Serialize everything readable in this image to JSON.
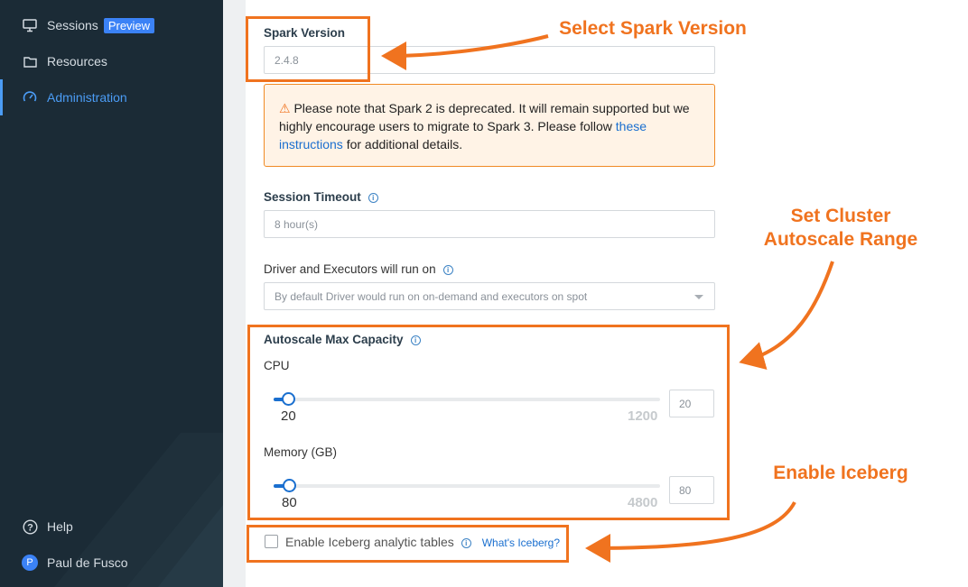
{
  "sidebar": {
    "items": [
      {
        "label": "Sessions",
        "icon": "monitor-icon",
        "badge": "Preview"
      },
      {
        "label": "Resources",
        "icon": "folder-icon"
      },
      {
        "label": "Administration",
        "icon": "gauge-icon",
        "active": true
      }
    ],
    "help": {
      "label": "Help",
      "icon": "help-icon"
    },
    "user": {
      "name": "Paul de Fusco",
      "initial": "P"
    }
  },
  "form": {
    "spark_version": {
      "label": "Spark Version",
      "value": "2.4.8"
    },
    "warning": {
      "text_before": " Please note that Spark 2 is deprecated. It will remain supported but we highly encourage users to migrate to Spark 3. Please follow ",
      "link": "these instructions",
      "text_after": " for additional details."
    },
    "session_timeout": {
      "label": "Session Timeout",
      "placeholder": "8 hour(s)"
    },
    "driver_executors": {
      "label": "Driver and Executors will run on",
      "placeholder": "By default Driver would run on on-demand and executors on spot"
    },
    "autoscale": {
      "label": "Autoscale Max Capacity",
      "cpu": {
        "label": "CPU",
        "min": "20",
        "max": "1200",
        "value": "20",
        "fraction": 0.0
      },
      "memory": {
        "label": "Memory (GB)",
        "min": "80",
        "max": "4800",
        "value": "80",
        "fraction": 0.0
      }
    },
    "iceberg": {
      "label": "Enable Iceberg analytic tables",
      "link": "What's Iceberg?",
      "checked": false
    }
  },
  "annotations": {
    "spark": "Select Spark Version",
    "autoscale_line1": "Set Cluster",
    "autoscale_line2": "Autoscale Range",
    "iceberg": "Enable Iceberg"
  },
  "colors": {
    "accent": "#f0731f",
    "primary": "#1a6fcf",
    "sidebar_bg": "#1b2b36"
  }
}
